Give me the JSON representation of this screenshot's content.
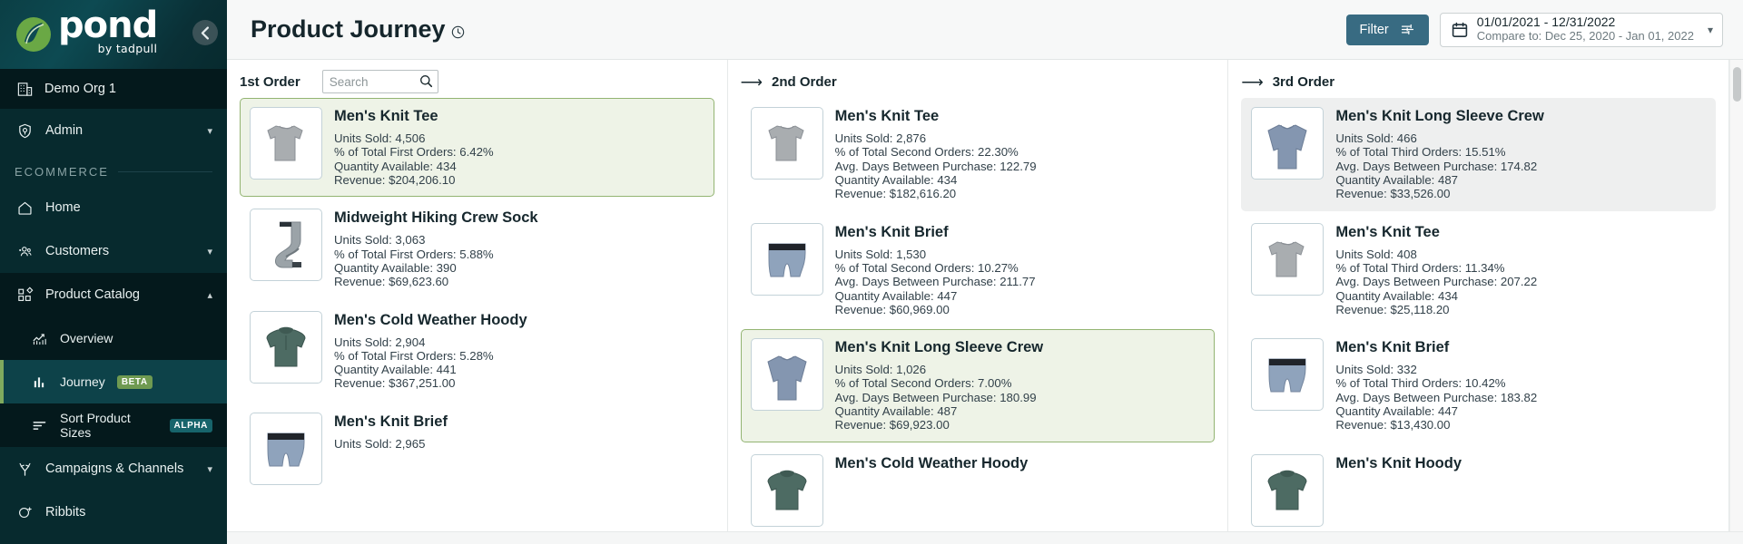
{
  "sidebar": {
    "logo": {
      "word": "pond",
      "sub": "by tadpull",
      "collapse_icon": "chevron-left-icon"
    },
    "org": {
      "label": "Demo Org 1",
      "icon": "building-icon"
    },
    "admin": {
      "label": "Admin",
      "icon": "shield-icon",
      "chevron": "chevron-down-icon"
    },
    "section_label": "ECOMMERCE",
    "items": [
      {
        "label": "Home",
        "icon": "home-icon"
      },
      {
        "label": "Customers",
        "icon": "users-icon",
        "chevron": "chevron-down-icon"
      },
      {
        "label": "Product Catalog",
        "icon": "grid-icon",
        "chevron": "chevron-up-icon"
      },
      {
        "label": "Overview",
        "icon": "chart-line-icon"
      },
      {
        "label": "Journey",
        "icon": "bar-chart-icon",
        "badge": "BETA"
      },
      {
        "label": "Sort Product Sizes",
        "icon": "sort-icon",
        "badge": "ALPHA"
      },
      {
        "label": "Campaigns & Channels",
        "icon": "branch-icon",
        "chevron": "chevron-down-icon"
      },
      {
        "label": "Ribbits",
        "icon": "ribbit-icon"
      }
    ]
  },
  "header": {
    "title": "Product Journey",
    "title_icon": "clock-icon",
    "filter_label": "Filter",
    "filter_icon": "sliders-icon",
    "calendar_icon": "calendar-icon",
    "date_range": "01/01/2021 - 12/31/2022",
    "date_compare": "Compare to: Dec 25, 2020 - Jan 01, 2022",
    "date_chevron": "chevron-down-icon"
  },
  "columns": [
    {
      "title": "1st Order",
      "arrow": false,
      "search_placeholder": "Search",
      "search_value": "",
      "cards": [
        {
          "name": "Men's Knit Tee",
          "image": "tee",
          "state": "selected",
          "metrics": [
            "Units Sold: 4,506",
            "% of Total First Orders: 6.42%",
            "Quantity Available: 434",
            "Revenue: $204,206.10"
          ]
        },
        {
          "name": "Midweight Hiking Crew Sock",
          "image": "sock",
          "state": "normal",
          "metrics": [
            "Units Sold: 3,063",
            "% of Total First Orders: 5.88%",
            "Quantity Available: 390",
            "Revenue: $69,623.60"
          ]
        },
        {
          "name": "Men's Cold Weather Hoody",
          "image": "hoody",
          "state": "normal",
          "metrics": [
            "Units Sold: 2,904",
            "% of Total First Orders: 5.28%",
            "Quantity Available: 441",
            "Revenue: $367,251.00"
          ]
        },
        {
          "name": "Men's Knit Brief",
          "image": "brief",
          "state": "normal",
          "metrics": [
            "Units Sold: 2,965"
          ]
        }
      ]
    },
    {
      "title": "2nd Order",
      "arrow": true,
      "cards": [
        {
          "name": "Men's Knit Tee",
          "image": "tee",
          "state": "normal",
          "metrics": [
            "Units Sold: 2,876",
            "% of Total Second Orders: 22.30%",
            "Avg. Days Between Purchase: 122.79",
            "Quantity Available: 434",
            "Revenue: $182,616.20"
          ]
        },
        {
          "name": "Men's Knit Brief",
          "image": "brief",
          "state": "normal",
          "metrics": [
            "Units Sold: 1,530",
            "% of Total Second Orders: 10.27%",
            "Avg. Days Between Purchase: 211.77",
            "Quantity Available: 447",
            "Revenue: $60,969.00"
          ]
        },
        {
          "name": "Men's Knit Long Sleeve Crew",
          "image": "longsleeve",
          "state": "selected",
          "metrics": [
            "Units Sold: 1,026",
            "% of Total Second Orders: 7.00%",
            "Avg. Days Between Purchase: 180.99",
            "Quantity Available: 487",
            "Revenue: $69,923.00"
          ]
        },
        {
          "name": "Men's Cold Weather Hoody",
          "image": "hoody",
          "state": "normal",
          "metrics": []
        }
      ]
    },
    {
      "title": "3rd Order",
      "arrow": true,
      "cards": [
        {
          "name": "Men's Knit Long Sleeve Crew",
          "image": "longsleeve",
          "state": "hovered",
          "metrics": [
            "Units Sold: 466",
            "% of Total Third Orders: 15.51%",
            "Avg. Days Between Purchase: 174.82",
            "Quantity Available: 487",
            "Revenue: $33,526.00"
          ]
        },
        {
          "name": "Men's Knit Tee",
          "image": "tee",
          "state": "normal",
          "metrics": [
            "Units Sold: 408",
            "% of Total Third Orders: 11.34%",
            "Avg. Days Between Purchase: 207.22",
            "Quantity Available: 434",
            "Revenue: $25,118.20"
          ]
        },
        {
          "name": "Men's Knit Brief",
          "image": "brief",
          "state": "normal",
          "metrics": [
            "Units Sold: 332",
            "% of Total Third Orders: 10.42%",
            "Avg. Days Between Purchase: 183.82",
            "Quantity Available: 447",
            "Revenue: $13,430.00"
          ]
        },
        {
          "name": "Men's Knit Hoody",
          "image": "hoody",
          "state": "normal",
          "metrics": []
        }
      ]
    }
  ],
  "colors": {
    "sidebar_bg": "#072a2e",
    "sidebar_active": "#0d4249",
    "accent_green": "#7faa5e",
    "filter_blue": "#386b82",
    "card_selected_bg": "#eef3e7",
    "card_selected_border": "#93b472"
  }
}
